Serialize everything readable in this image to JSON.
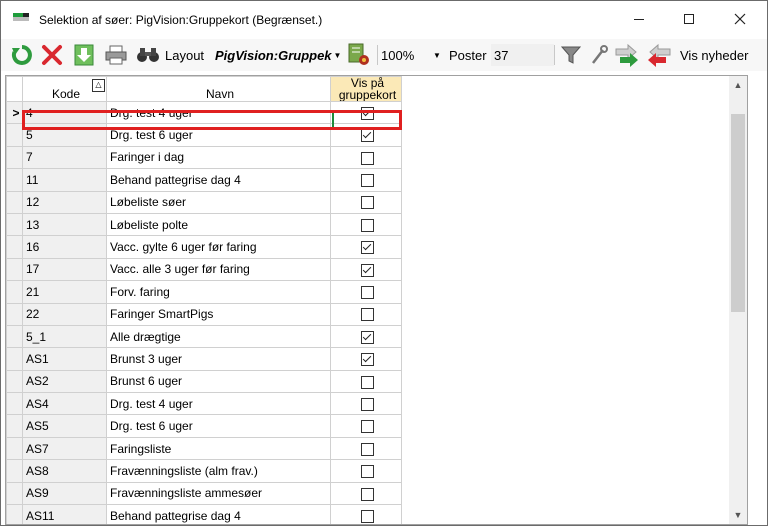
{
  "window": {
    "title": "Selektion af søer: PigVision:Gruppekort (Begrænset.)",
    "controls": [
      "minimize",
      "maximize",
      "close"
    ]
  },
  "toolbar": {
    "icons": [
      "refresh-icon",
      "delete-icon",
      "download-icon",
      "print-icon",
      "binoculars-icon",
      "layout-settings-icon",
      "filter-icon",
      "wrench-icon",
      "green-arrows-icon",
      "red-arrows-icon"
    ],
    "layout_label": "Layout",
    "layout_value": "PigVision:Gruppek",
    "zoom_value": "100%",
    "poster_label": "Poster",
    "poster_count": "37",
    "news_label": "Vis nyheder",
    "colors": {
      "refresh": "#2e9b3e",
      "delete": "#d9282f",
      "download": "#3ca03c",
      "layout_gear": "#5a8a2a"
    }
  },
  "grid": {
    "columns": {
      "kode": "Kode",
      "navn": "Navn",
      "vis_line1": "Vis på",
      "vis_line2": "gruppekort"
    },
    "sort_indicator": "△",
    "current_row_marker": ">",
    "selected_row_index": 0,
    "rows": [
      {
        "kode": "4",
        "navn": "Drg. test 4 uger",
        "vis": true
      },
      {
        "kode": "5",
        "navn": "Drg. test 6 uger",
        "vis": true
      },
      {
        "kode": "7",
        "navn": "Faringer i dag",
        "vis": false
      },
      {
        "kode": "11",
        "navn": "Behand pattegrise dag 4",
        "vis": false
      },
      {
        "kode": "12",
        "navn": "Løbeliste søer",
        "vis": false
      },
      {
        "kode": "13",
        "navn": "Løbeliste polte",
        "vis": false
      },
      {
        "kode": "16",
        "navn": "Vacc. gylte 6 uger før faring",
        "vis": true
      },
      {
        "kode": "17",
        "navn": "Vacc. alle 3 uger før faring",
        "vis": true
      },
      {
        "kode": "21",
        "navn": "Forv. faring",
        "vis": false
      },
      {
        "kode": "22",
        "navn": "Faringer SmartPigs",
        "vis": false
      },
      {
        "kode": "5_1",
        "navn": "Alle drægtige",
        "vis": true
      },
      {
        "kode": "AS1",
        "navn": "Brunst 3 uger",
        "vis": true
      },
      {
        "kode": "AS2",
        "navn": "Brunst 6 uger",
        "vis": false
      },
      {
        "kode": "AS4",
        "navn": "Drg. test 4 uger",
        "vis": false
      },
      {
        "kode": "AS5",
        "navn": "Drg. test 6 uger",
        "vis": false
      },
      {
        "kode": "AS7",
        "navn": "Faringsliste",
        "vis": false
      },
      {
        "kode": "AS8",
        "navn": "Fravænningsliste (alm frav.)",
        "vis": false
      },
      {
        "kode": "AS9",
        "navn": "Fravænningsliste ammesøer",
        "vis": false
      },
      {
        "kode": "AS11",
        "navn": "Behand pattegrise dag 4",
        "vis": false
      }
    ]
  }
}
